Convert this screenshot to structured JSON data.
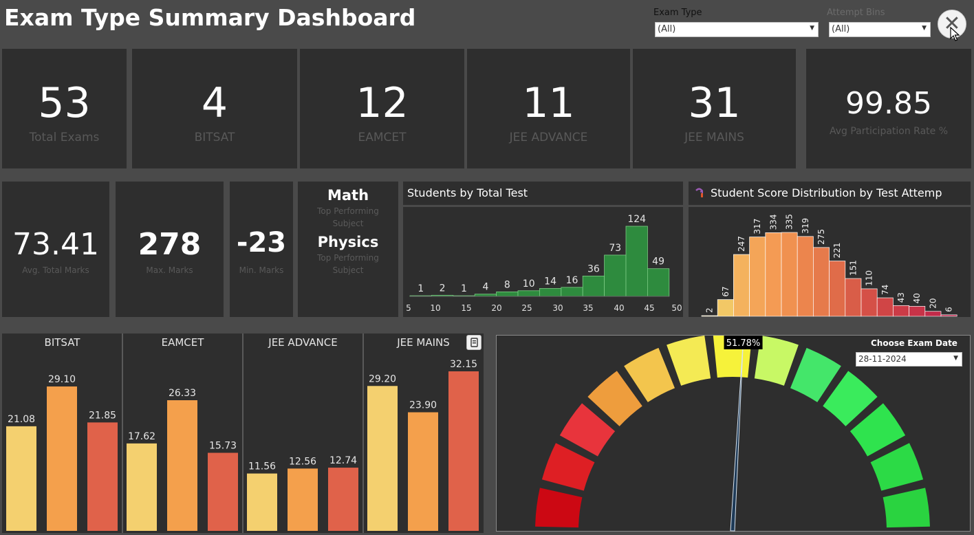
{
  "header": {
    "title": "Exam Type Summary Dashboard",
    "filters": [
      {
        "label": "Exam Type",
        "value": "(All)"
      },
      {
        "label": "Attempt Bins",
        "value": "(All)"
      }
    ],
    "close_glyph": "✕"
  },
  "kpis": [
    {
      "value": "53",
      "label": "Total Exams"
    },
    {
      "value": "4",
      "label": "BITSAT"
    },
    {
      "value": "12",
      "label": "EAMCET"
    },
    {
      "value": "11",
      "label": "JEE ADVANCE"
    },
    {
      "value": "31",
      "label": "JEE MAINS"
    },
    {
      "value": "99.85",
      "label": "Avg Participation Rate %"
    }
  ],
  "marks": [
    {
      "value": "73.41",
      "label": "Avg. Total Marks"
    },
    {
      "value": "278",
      "label": "Max. Marks"
    },
    {
      "value": "-23",
      "label": "Min. Marks"
    }
  ],
  "subjects": [
    {
      "name": "Math",
      "caption_1": "Top Performing",
      "caption_2": "Subject"
    },
    {
      "name": "Physics",
      "caption_1": "Top Performing",
      "caption_2": "Subject"
    }
  ],
  "students_chart_title": "Students by Total Test",
  "score_chart_title": "Student Score Distribution by Test Attemp",
  "gauge": {
    "value": 51.78,
    "label": "51.78%"
  },
  "date_filter": {
    "label": "Choose Exam Date",
    "value": "28-11-2024"
  },
  "colors": {
    "green": "#2e8b3e",
    "green_light": "#38a04a",
    "card": "#2e2e2e",
    "background": "#4a4a4a"
  },
  "icons": {
    "close": "close-icon",
    "score_chart": "filter-icon",
    "copy": "copy-icon"
  },
  "chart_data": [
    {
      "type": "bar",
      "title": "Students by Total Test",
      "x_tick_labels": [
        "5",
        "10",
        "15",
        "20",
        "25",
        "30",
        "35",
        "40",
        "45",
        "50"
      ],
      "series": [
        {
          "values": [
            1,
            2,
            1,
            4,
            8,
            10,
            14,
            16,
            36,
            73,
            124,
            49
          ]
        }
      ],
      "color": "#2e8b3e"
    },
    {
      "type": "bar",
      "title": "Student Score Distribution by Test Attemp",
      "series": [
        {
          "values": [
            2,
            67,
            247,
            317,
            334,
            335,
            319,
            275,
            221,
            151,
            110,
            74,
            43,
            40,
            20,
            6
          ]
        }
      ],
      "colors": [
        "#f2d06b",
        "#f2c866",
        "#f4b25e",
        "#f4a558",
        "#f49b54",
        "#f09150",
        "#ec854d",
        "#e67a4b",
        "#e06c49",
        "#d95d48",
        "#d55047",
        "#d04546",
        "#cc3b47",
        "#c83348",
        "#c32b4a",
        "#c0244c"
      ]
    },
    {
      "type": "bar",
      "groups": [
        {
          "name": "BITSAT",
          "values": [
            21.08,
            29.1,
            21.85
          ]
        },
        {
          "name": "EAMCET",
          "values": [
            17.62,
            26.33,
            15.73
          ]
        },
        {
          "name": "JEE ADVANCE",
          "values": [
            11.56,
            12.56,
            12.74
          ]
        },
        {
          "name": "JEE MAINS",
          "values": [
            29.2,
            23.9,
            32.15
          ]
        }
      ],
      "bar_colors": [
        "#f4d06f",
        "#f4a04c",
        "#e0624a"
      ]
    },
    {
      "type": "gauge",
      "value": 51.78,
      "range": [
        0,
        100
      ],
      "segment_colors": [
        "#cc0813",
        "#de1f24",
        "#e8343c",
        "#ee9d3d",
        "#f3c54d",
        "#f4ea54",
        "#f6f23a",
        "#c8f865",
        "#44e66a",
        "#3aeb5c",
        "#2fe34e",
        "#2cda46",
        "#2ad340"
      ]
    }
  ]
}
